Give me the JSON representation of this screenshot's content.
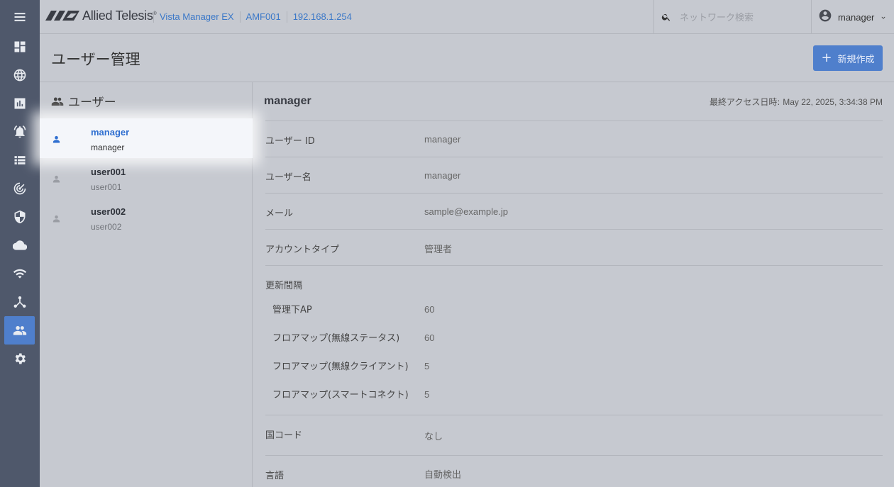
{
  "header": {
    "logo_text": "Allied Telesis",
    "logo_sup": "®",
    "crumbs": [
      "Vista Manager EX",
      "AMF001",
      "192.168.1.254"
    ],
    "search_placeholder": "ネットワーク検索",
    "user": "manager"
  },
  "nav": {
    "items": [
      "menu",
      "dashboard",
      "network",
      "reports",
      "alerts",
      "devices",
      "radar",
      "security",
      "cloud",
      "wireless",
      "topology",
      "users",
      "settings"
    ],
    "active": "users"
  },
  "page": {
    "title": "ユーザー管理",
    "new_button": "新規作成"
  },
  "user_list": {
    "heading": "ユーザー",
    "users": [
      {
        "id": "manager",
        "name": "manager",
        "selected": true
      },
      {
        "id": "user001",
        "name": "user001",
        "selected": false
      },
      {
        "id": "user002",
        "name": "user002",
        "selected": false
      }
    ]
  },
  "detail": {
    "title": "manager",
    "last_access_label": "最終アクセス日時:",
    "last_access_value": "May 22, 2025, 3:34:38 PM",
    "fields": [
      {
        "label": "ユーザー ID",
        "value": "manager"
      },
      {
        "label": "ユーザー名",
        "value": "manager"
      },
      {
        "label": "メール",
        "value": "sample@example.jp"
      },
      {
        "label": "アカウントタイプ",
        "value": "管理者"
      }
    ],
    "interval": {
      "label": "更新間隔",
      "items": [
        {
          "label": "管理下AP",
          "value": "60"
        },
        {
          "label": "フロアマップ(無線ステータス)",
          "value": "60"
        },
        {
          "label": "フロアマップ(無線クライアント)",
          "value": "5"
        },
        {
          "label": "フロアマップ(スマートコネクト)",
          "value": "5"
        }
      ]
    },
    "country": {
      "label": "国コード",
      "value": "なし"
    },
    "language": {
      "label": "言語",
      "value": "自動検出"
    }
  },
  "colors": {
    "accent": "#4f7fcc",
    "rail": "#4f586b",
    "background": "#c6c9d0",
    "link": "#3b78c8"
  }
}
